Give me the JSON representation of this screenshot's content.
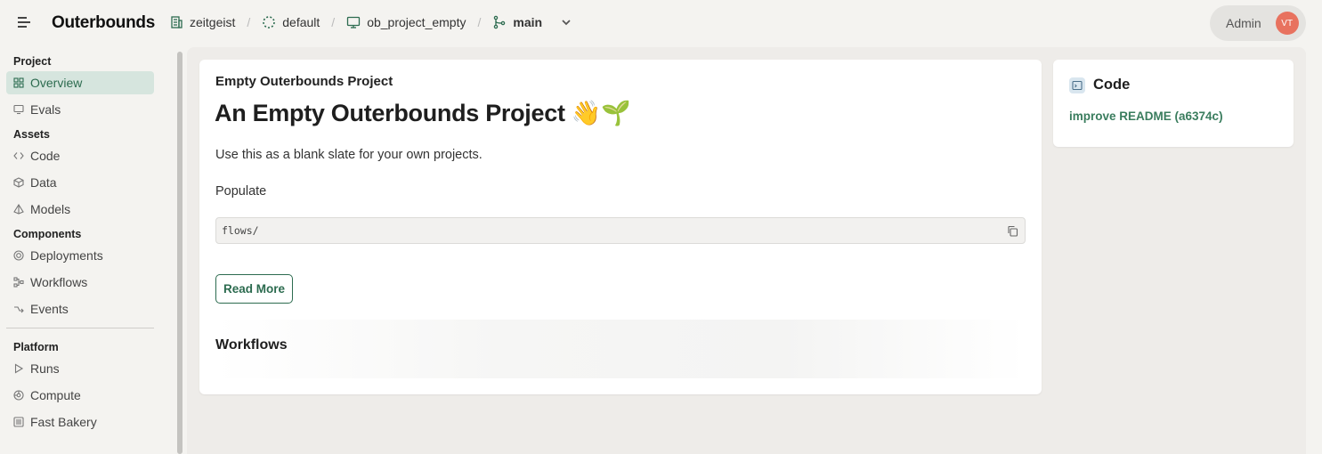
{
  "header": {
    "brand": "Outerbounds",
    "breadcrumbs": [
      {
        "label": "zeitgeist",
        "icon": "building-icon"
      },
      {
        "label": "default",
        "icon": "dashed-circle-icon"
      },
      {
        "label": "ob_project_empty",
        "icon": "monitor-icon"
      },
      {
        "label": "main",
        "icon": "git-branch-icon"
      }
    ],
    "separator": "/",
    "user": {
      "name": "Admin",
      "initials": "VT",
      "avatar_color": "#e8725f"
    }
  },
  "sidebar": {
    "sections": [
      {
        "title": "Project",
        "items": [
          {
            "label": "Overview",
            "icon": "grid-icon",
            "active": true
          },
          {
            "label": "Evals",
            "icon": "monitor-icon"
          }
        ]
      },
      {
        "title": "Assets",
        "items": [
          {
            "label": "Code",
            "icon": "code-brackets-icon"
          },
          {
            "label": "Data",
            "icon": "cube-icon"
          },
          {
            "label": "Models",
            "icon": "pyramid-icon"
          }
        ]
      },
      {
        "title": "Components",
        "items": [
          {
            "label": "Deployments",
            "icon": "target-icon"
          },
          {
            "label": "Workflows",
            "icon": "workflow-icon"
          },
          {
            "label": "Events",
            "icon": "event-arrow-icon"
          }
        ]
      },
      {
        "title": "Platform",
        "items": [
          {
            "label": "Runs",
            "icon": "play-icon"
          },
          {
            "label": "Compute",
            "icon": "compute-icon"
          },
          {
            "label": "Fast Bakery",
            "icon": "bakery-icon"
          }
        ]
      }
    ]
  },
  "main": {
    "subtitle": "Empty Outerbounds Project",
    "title": "An Empty Outerbounds Project 👋🌱",
    "description": "Use this as a blank slate for your own projects.",
    "populate_label": "Populate",
    "code_snippet": "flows/",
    "read_more_label": "Read More",
    "workflows_title": "Workflows"
  },
  "code_panel": {
    "title": "Code",
    "commit_link": "improve README (a6374c)"
  },
  "colors": {
    "accent": "#2c6b4f",
    "active_bg": "#d6e5de",
    "page_bg": "#f4f3f0"
  }
}
